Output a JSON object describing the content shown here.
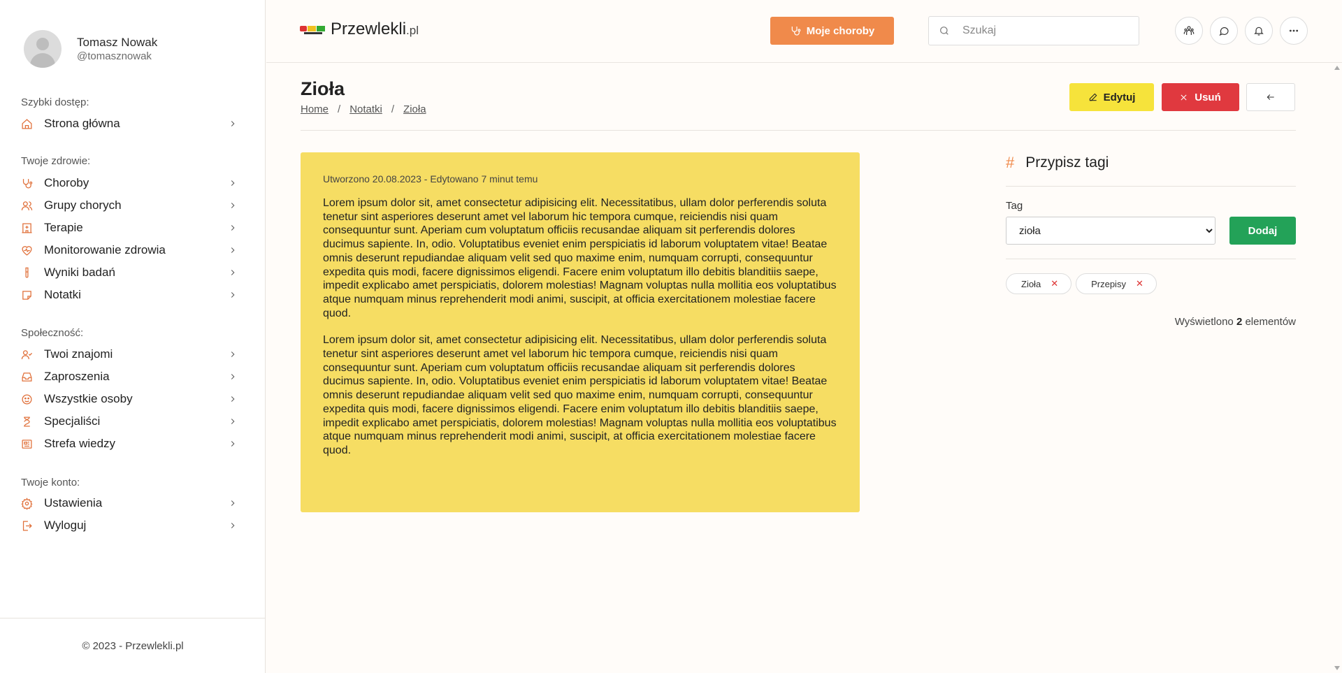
{
  "user": {
    "name": "Tomasz Nowak",
    "handle": "@tomasznowak"
  },
  "sidebar": {
    "sections": [
      {
        "label": "Szybki dostęp:",
        "items": [
          {
            "label": "Strona główna",
            "icon": "home-icon"
          }
        ]
      },
      {
        "label": "Twoje zdrowie:",
        "items": [
          {
            "label": "Choroby",
            "icon": "stethoscope-icon"
          },
          {
            "label": "Grupy chorych",
            "icon": "users-icon"
          },
          {
            "label": "Terapie",
            "icon": "hospital-icon"
          },
          {
            "label": "Monitorowanie zdrowia",
            "icon": "heart-pulse-icon"
          },
          {
            "label": "Wyniki badań",
            "icon": "test-tube-icon"
          },
          {
            "label": "Notatki",
            "icon": "sticky-note-icon"
          }
        ]
      },
      {
        "label": "Społeczność:",
        "items": [
          {
            "label": "Twoi znajomi",
            "icon": "user-check-icon"
          },
          {
            "label": "Zaproszenia",
            "icon": "inbox-icon"
          },
          {
            "label": "Wszystkie osoby",
            "icon": "smile-group-icon"
          },
          {
            "label": "Specjaliści",
            "icon": "doctor-icon"
          },
          {
            "label": "Strefa wiedzy",
            "icon": "newspaper-icon"
          }
        ]
      },
      {
        "label": "Twoje konto:",
        "items": [
          {
            "label": "Ustawienia",
            "icon": "gear-icon"
          },
          {
            "label": "Wyloguj",
            "icon": "logout-icon"
          }
        ]
      }
    ],
    "footer": "© 2023 - Przewlekli.pl"
  },
  "topbar": {
    "logo_main": "Przewlekli",
    "logo_suffix": ".pl",
    "moje_choroby": "Moje choroby",
    "search_placeholder": "Szukaj",
    "icons": [
      "people-group-icon",
      "chat-icon",
      "bell-icon",
      "more-icon"
    ]
  },
  "page": {
    "title": "Zioła",
    "breadcrumb": [
      "Home",
      "Notatki",
      "Zioła"
    ],
    "edit_label": "Edytuj",
    "delete_label": "Usuń"
  },
  "note": {
    "meta": "Utworzono 20.08.2023 - Edytowano 7 minut temu",
    "paragraphs": [
      "Lorem ipsum dolor sit, amet consectetur adipisicing elit. Necessitatibus, ullam dolor perferendis soluta tenetur sint asperiores deserunt amet vel laborum hic tempora cumque, reiciendis nisi quam consequuntur sunt. Aperiam cum voluptatum officiis recusandae aliquam sit perferendis dolores ducimus sapiente. In, odio. Voluptatibus eveniet enim perspiciatis id laborum voluptatem vitae! Beatae omnis deserunt repudiandae aliquam velit sed quo maxime enim, numquam corrupti, consequuntur expedita quis modi, facere dignissimos eligendi. Facere enim voluptatum illo debitis blanditiis saepe, impedit explicabo amet perspiciatis, dolorem molestias! Magnam voluptas nulla mollitia eos voluptatibus atque numquam minus reprehenderit modi animi, suscipit, at officia exercitationem molestiae facere quod.",
      "Lorem ipsum dolor sit, amet consectetur adipisicing elit. Necessitatibus, ullam dolor perferendis soluta tenetur sint asperiores deserunt amet vel laborum hic tempora cumque, reiciendis nisi quam consequuntur sunt. Aperiam cum voluptatum officiis recusandae aliquam sit perferendis dolores ducimus sapiente. In, odio. Voluptatibus eveniet enim perspiciatis id laborum voluptatem vitae! Beatae omnis deserunt repudiandae aliquam velit sed quo maxime enim, numquam corrupti, consequuntur expedita quis modi, facere dignissimos eligendi. Facere enim voluptatum illo debitis blanditiis saepe, impedit explicabo amet perspiciatis, dolorem molestias! Magnam voluptas nulla mollitia eos voluptatibus atque numquam minus reprehenderit modi animi, suscipit, at officia exercitationem molestiae facere quod."
    ]
  },
  "tags": {
    "title": "Przypisz tagi",
    "tag_label": "Tag",
    "selected": "zioła",
    "add_label": "Dodaj",
    "chips": [
      "Zioła",
      "Przepisy"
    ],
    "count_prefix": "Wyświetlono",
    "count": "2",
    "count_suffix": "elementów"
  },
  "colors": {
    "accent": "#f08a4b",
    "note_bg": "#f6dd63",
    "edit": "#f6e33b",
    "delete": "#e0393f",
    "add": "#23a258"
  }
}
